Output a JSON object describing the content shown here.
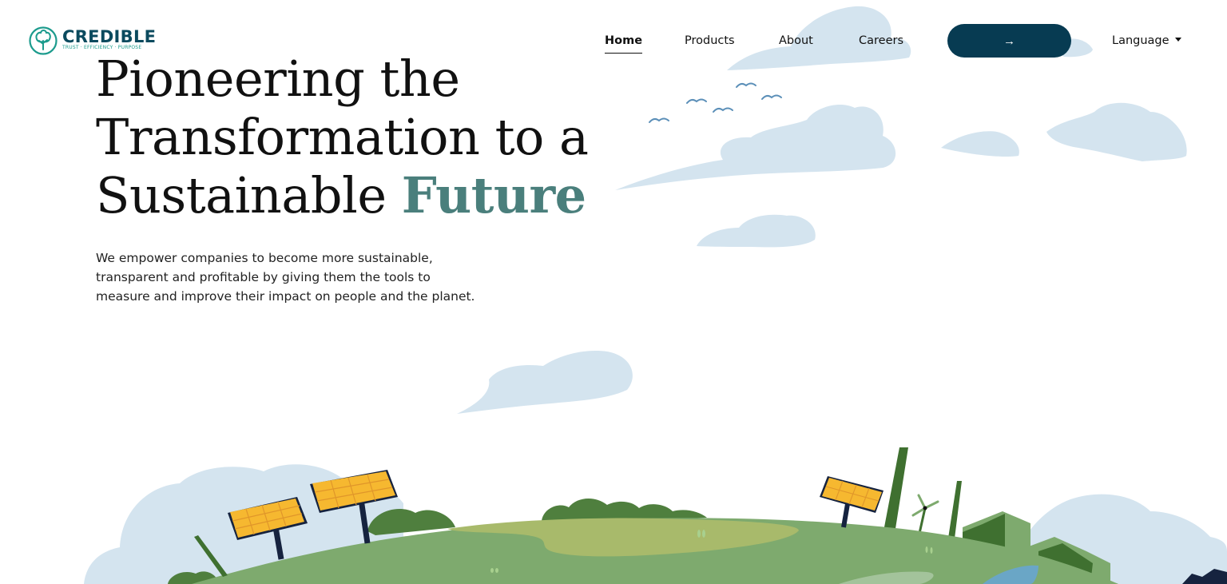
{
  "brand": {
    "name": "CREDIBLE",
    "tagline": "TRUST · EFFICIENCY · PURPOSE"
  },
  "nav": {
    "items": [
      {
        "label": "Home",
        "active": true
      },
      {
        "label": "Products",
        "active": false
      },
      {
        "label": "About",
        "active": false
      },
      {
        "label": "Careers",
        "active": false
      }
    ],
    "cta_icon": "arrow-right-icon",
    "cta_glyph": "→",
    "language_label": "Language"
  },
  "hero": {
    "title_main": "Pioneering the Transformation to a Sustainable ",
    "title_accent": "Future",
    "subtitle": "We empower companies to become more sustainable, transparent and profitable by giving them the tools to measure and improve their impact on people and the planet."
  },
  "colors": {
    "brand_dark": "#0b4a5e",
    "brand_teal": "#1c9b8d",
    "accent_text": "#4a7f7c",
    "cta_bg": "#073b52",
    "cloud": "#d4e4ef",
    "ground": "#7eaa6e",
    "solar": "#f6b830"
  }
}
